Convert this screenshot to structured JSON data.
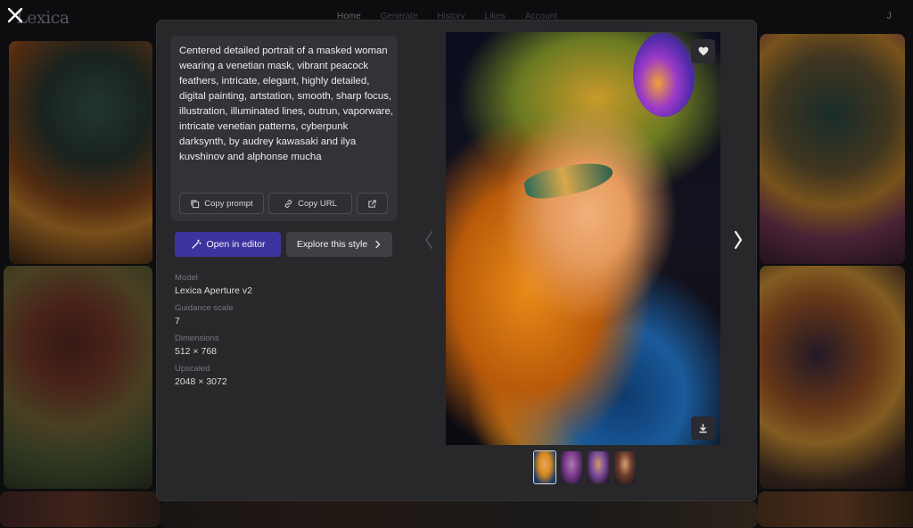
{
  "background": {
    "logo": "Lexica",
    "nav": [
      "Home",
      "Generate",
      "History",
      "Likes",
      "Account"
    ],
    "user_initial": "J"
  },
  "modal": {
    "prompt": "Centered detailed portrait of a masked woman wearing a venetian mask, vibrant peacock feathers, intricate, elegant, highly detailed, digital painting, artstation, smooth, sharp focus, illustration, illuminated lines, outrun, vaporware, intricate venetian patterns, cyberpunk darksynth, by audrey kawasaki and ilya kuvshinov and alphonse mucha",
    "buttons": {
      "copy_prompt": "Copy prompt",
      "copy_url": "Copy URL",
      "open_in_editor": "Open in editor",
      "explore_style": "Explore this style"
    },
    "details": [
      {
        "label": "Model",
        "value": "Lexica Aperture v2"
      },
      {
        "label": "Guidance scale",
        "value": "7"
      },
      {
        "label": "Dimensions",
        "value": "512 × 768"
      },
      {
        "label": "Upscaled",
        "value": "2048 × 3072"
      }
    ]
  },
  "colors": {
    "accent": "#3d34a0",
    "modal_bg": "#28282b",
    "card_bg": "#333337"
  }
}
